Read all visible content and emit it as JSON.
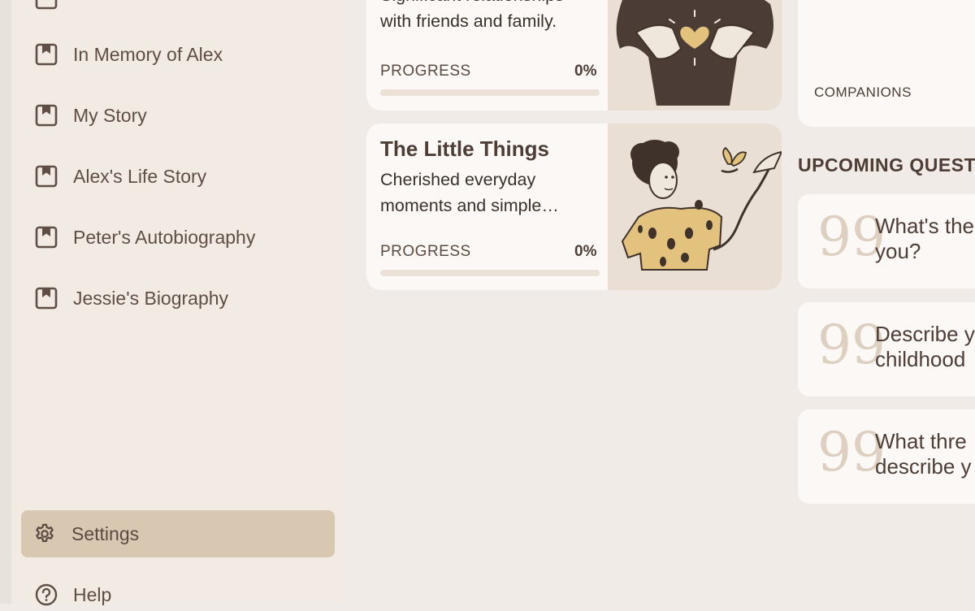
{
  "sidebar": {
    "items": [
      {
        "label": "",
        "icon": "bookmark-icon"
      },
      {
        "label": "In Memory of Alex",
        "icon": "bookmark-icon"
      },
      {
        "label": "My Story",
        "icon": "bookmark-icon"
      },
      {
        "label": "Alex's Life Story",
        "icon": "bookmark-icon"
      },
      {
        "label": "Peter's Autobiography",
        "icon": "bookmark-icon"
      },
      {
        "label": "Jessie's Biography",
        "icon": "bookmark-icon"
      }
    ],
    "settings": {
      "label": "Settings",
      "icon": "gear-icon"
    },
    "help": {
      "label": "Help",
      "icon": "help-icon"
    }
  },
  "cards": [
    {
      "title": "",
      "description_line1": "Significant relationships",
      "description_line2": "with friends and family.",
      "progress_label": "PROGRESS",
      "progress_value": "0%",
      "progress": 0,
      "illustration": "heart-hands-illustration"
    },
    {
      "title": "The Little Things",
      "description_line1": "Cherished everyday",
      "description_line2": "moments and simple…",
      "progress_label": "PROGRESS",
      "progress_value": "0%",
      "progress": 0,
      "illustration": "person-butterfly-illustration"
    }
  ],
  "companions": {
    "label": "COMPANIONS"
  },
  "upcoming": {
    "heading": "UPCOMING QUESTI",
    "questions": [
      {
        "line1": "What's the",
        "line2": "you?"
      },
      {
        "line1": "Describe y",
        "line2": "childhood"
      },
      {
        "line1": "What thre",
        "line2": "describe y"
      }
    ],
    "quote_glyph": "99"
  },
  "colors": {
    "sidebar_bg": "#f2ebe3",
    "main_bg": "#f0ebe6",
    "card_bg": "#fcf8f5",
    "selected_bg": "#d8c8b2",
    "text_dark": "#4d3d35",
    "accent_gold": "#e3c27e"
  }
}
